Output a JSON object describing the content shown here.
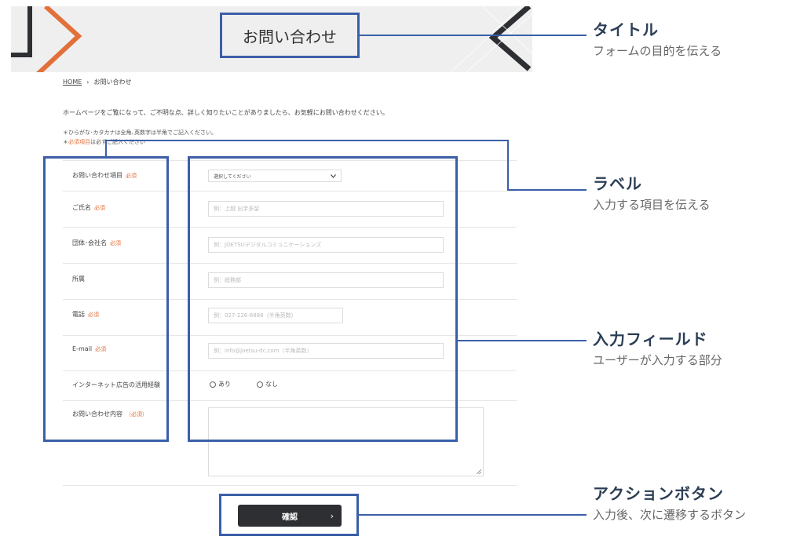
{
  "header": {
    "title": "お問い合わせ"
  },
  "breadcrumb": {
    "home": "HOME",
    "separator": "›",
    "current": "お問い合わせ"
  },
  "intro": "ホームページをご覧になって、ご不明な点、詳しく知りたいことがありましたら、お気軽にお問い合わせください。",
  "notes": {
    "line1": "＊ひらがな･カタカナは全角､英数字は半角でご記入ください。",
    "line2_prefix": "＊",
    "line2_required": "必須項目",
    "line2_suffix": "は必ずご記入ください"
  },
  "required_mark": "必須",
  "form": {
    "inquiry_type": {
      "label": "お問い合わせ項目",
      "value": "選択してください"
    },
    "name": {
      "label": "ご氏名",
      "placeholder": "例：上越 出字多留"
    },
    "company": {
      "label": "団体･会社名",
      "placeholder": "例：JOETSUデジタルコミュニケーションズ"
    },
    "department": {
      "label": "所属",
      "placeholder": "例：総務部"
    },
    "phone": {
      "label": "電話",
      "placeholder": "例：027-226-6888（半角英数）"
    },
    "email": {
      "label": "E-mail",
      "placeholder": "例：info@joetsu-dc.com（半角英数）"
    },
    "ad_experience": {
      "label": "インターネット広告の活用経験",
      "options": [
        "あり",
        "なし"
      ]
    },
    "message": {
      "label": "お問い合わせ内容",
      "required_mark": "（必須）"
    }
  },
  "submit": {
    "label": "確認",
    "chevron": "›"
  },
  "annotations": [
    {
      "title": "タイトル",
      "desc": "フォームの目的を伝える"
    },
    {
      "title": "ラベル",
      "desc": "入力する項目を伝える"
    },
    {
      "title": "入力フィールド",
      "desc": "ユーザーが入力する部分"
    },
    {
      "title": "アクションボタン",
      "desc": "入力後、次に遷移するボタン"
    }
  ],
  "colors": {
    "highlight": "#3b5fa8",
    "accent_orange": "#e2703a",
    "button": "#2d2f33",
    "banner_bg": "#efefef"
  }
}
